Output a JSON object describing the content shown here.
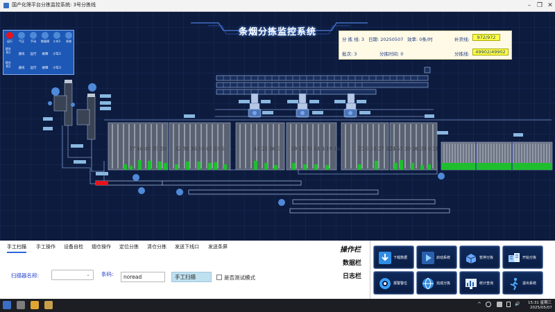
{
  "window": {
    "title": "国产化筛平台分拣监控系统: 3号分拣线",
    "minimize_glyph": "–",
    "maximize_glyph": "❐",
    "close_glyph": "✕"
  },
  "scada": {
    "title": "条烟分拣监控系统",
    "status_panel": {
      "top_items": [
        {
          "label": "运行",
          "state": "on"
        },
        {
          "label": "气压",
          "state": "off"
        },
        {
          "label": "手动",
          "state": "off"
        },
        {
          "label": "数量阈",
          "state": "off"
        },
        {
          "label": "小车1",
          "state": "off"
        },
        {
          "label": "系统",
          "state": "off"
        }
      ],
      "rows": [
        {
          "label": "提升机1",
          "values": [
            "通讯",
            "运行",
            "故障"
          ],
          "extra": "小车2"
        },
        {
          "label": "提升机2",
          "values": [
            "通讯",
            "运行",
            "故障"
          ],
          "extra": "小车3"
        }
      ]
    },
    "info_panel": {
      "line": "分 拣 线: 3",
      "date": "日期: 20250507",
      "efficiency": "效率: 0条/时",
      "restock_label": "补货线:",
      "restock_value": "972/972",
      "batch": "批次: 3",
      "sort_time": "分拣时间: 0",
      "sortline_label": "分拣线:",
      "sortline_value": "49902/49902"
    },
    "bin_groups": [
      {
        "labels": "37 46 40 35 20"
      },
      {
        "labels": "32 38 36 30 43 29 6"
      },
      {
        "labels": "41 25 16 5"
      },
      {
        "labels": "20 12 31 51 3 19 14"
      },
      {
        "labels": "23 6 26 27 37"
      },
      {
        "labels": "24 51 39 26 29 0 21"
      }
    ]
  },
  "tabs": [
    {
      "label": "手工扫描",
      "active": true
    },
    {
      "label": "手工操作",
      "active": false
    },
    {
      "label": "设备自检",
      "active": false
    },
    {
      "label": "烟仓操作",
      "active": false
    },
    {
      "label": "定位分拣",
      "active": false
    },
    {
      "label": "清仓分拣",
      "active": false
    },
    {
      "label": "发送下线口",
      "active": false
    },
    {
      "label": "发送条屏",
      "active": false
    }
  ],
  "form": {
    "scanner_label": "扫描器名称:",
    "scanner_value": "",
    "barcode_label": "条码:",
    "barcode_value": "noread",
    "scan_button": "手工扫描",
    "test_mode_label": "是否测试模式",
    "test_mode_checked": false
  },
  "side_labels": {
    "operation": "操作栏",
    "data": "数据栏",
    "log": "日志栏"
  },
  "function_buttons": [
    {
      "label": "下载数据",
      "icon": "download-icon",
      "color": "#2f8de4"
    },
    {
      "label": "启动系统",
      "icon": "start-icon",
      "color": "#3ab0ff"
    },
    {
      "label": "暂停分拣",
      "icon": "pause-icon",
      "color": "#6aa8ff"
    },
    {
      "label": "开始分拣",
      "icon": "sort-icon",
      "color": "#9fd0ff"
    },
    {
      "label": "报警警位",
      "icon": "alarm-icon",
      "color": "#3aa0ff"
    },
    {
      "label": "完成分拣",
      "icon": "globe-icon",
      "color": "#2f8de4"
    },
    {
      "label": "统计查询",
      "icon": "chart-icon",
      "color": "#4dd0ff"
    },
    {
      "label": "退出系统",
      "icon": "exit-icon",
      "color": "#4fb0ff"
    }
  ],
  "taskbar": {
    "time": "15:31 星期三",
    "date": "2025/05/07",
    "tray_up": "^",
    "tray_speaker": "🔊"
  }
}
